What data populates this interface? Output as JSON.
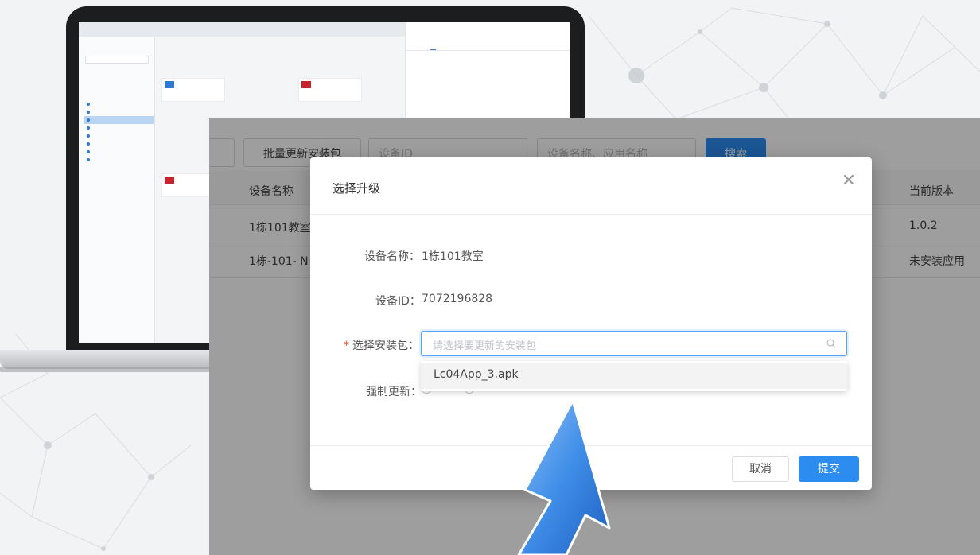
{
  "colors": {
    "accent": "#2d8cf0",
    "arrow_blue": "#3f8ee8",
    "overlay": "#7b7c80",
    "laptop_frame": "#1c1d1f"
  },
  "toolbar": {
    "batch_update_label": "批量更新安装包",
    "device_id_placeholder": "设备ID",
    "device_name_placeholder": "设备名称、应用名称",
    "search_label": "搜索"
  },
  "table": {
    "headers": {
      "device_name": "设备名称",
      "current_version": "当前版本"
    },
    "rows": [
      {
        "device_name": "1栋101教室",
        "current_version": "1.0.2"
      },
      {
        "device_name": "1栋-101- N",
        "current_version": "未安装应用"
      }
    ]
  },
  "modal": {
    "title": "选择升级",
    "close_icon": "close-icon",
    "device_name_label": "设备名称：",
    "device_name_value": "1栋101教室",
    "device_id_label": "设备ID：",
    "device_id_value": "7072196828",
    "package_label": "选择安装包：",
    "package_placeholder": "请选择要更新的安装包",
    "package_options": [
      "Lc04App_3.apk"
    ],
    "force_update_label": "强制更新：",
    "cancel_label": "取消",
    "submit_label": "提交"
  }
}
